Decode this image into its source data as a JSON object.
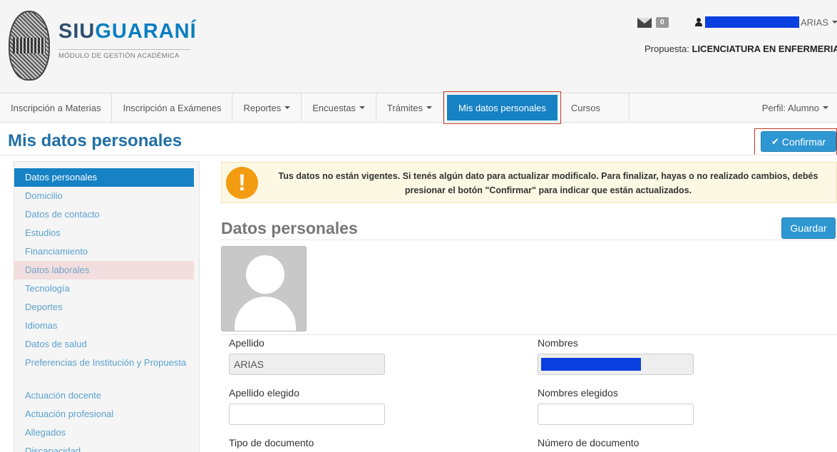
{
  "header": {
    "brand_siu": "SIU",
    "brand_guarani": "GUARANÍ",
    "brand_sub": "MÓDULO DE GESTIÓN ACADÉMICA",
    "mail_count": "0",
    "user_last": "ARIAS",
    "propuesta_label": "Propuesta:",
    "propuesta_value": "LICENCIATURA EN ENFERMERIA"
  },
  "nav": {
    "items": [
      "Inscripción a Materias",
      "Inscripción a Exámenes",
      "Reportes",
      "Encuestas",
      "Trámites",
      "Mis datos personales",
      "Cursos"
    ],
    "perfil": "Perfil: Alumno"
  },
  "page": {
    "title": "Mis datos personales",
    "confirm_label": "Confirmar"
  },
  "sidebar": {
    "items": [
      "Datos personales",
      "Domicilio",
      "Datos de contacto",
      "Estudios",
      "Financiamiento",
      "Datos laborales",
      "Tecnología",
      "Deportes",
      "Idiomas",
      "Datos de salud",
      "Preferencias de Institución y Propuesta",
      "Actuación docente",
      "Actuación profesional",
      "Allegados",
      "Discapacidad"
    ]
  },
  "alert": {
    "icon": "!",
    "text": "Tus datos no están vigentes. Si tenés algún dato para actualizar modificalo. Para finalizar, hayas o no realizado cambios, debés presionar el botón \"Confirmar\" para indicar que están actualizados."
  },
  "section": {
    "title": "Datos personales",
    "save_label": "Guardar"
  },
  "form": {
    "apellido_label": "Apellido",
    "apellido_value": "ARIAS",
    "nombres_label": "Nombres",
    "apellido_elegido_label": "Apellido elegido",
    "apellido_elegido_value": "",
    "nombres_elegidos_label": "Nombres elegidos",
    "nombres_elegidos_value": "",
    "tipo_doc_label": "Tipo de documento",
    "numero_doc_label": "Número de documento"
  },
  "colors": {
    "primary": "#1682c4",
    "button": "#2e97d1",
    "alert_bg": "#fcf8e3",
    "alert_icon": "#f39c12",
    "highlight_border": "#c0392b",
    "redaction": "#0a3fe0"
  }
}
